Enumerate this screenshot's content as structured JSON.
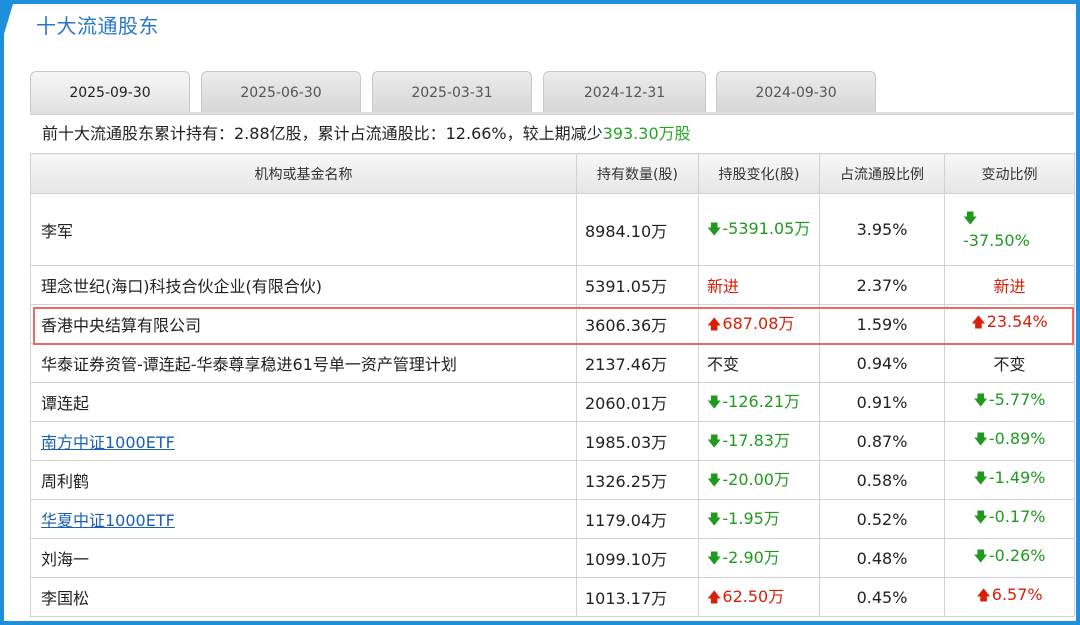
{
  "section": {
    "title": "十大流通股东"
  },
  "tabs": [
    {
      "label": "2025-09-30",
      "active": true
    },
    {
      "label": "2025-06-30",
      "active": false
    },
    {
      "label": "2025-03-31",
      "active": false
    },
    {
      "label": "2024-12-31",
      "active": false
    },
    {
      "label": "2024-09-30",
      "active": false
    }
  ],
  "summary": {
    "prefix": "前十大流通股东累计持有：2.88亿股，累计占流通股比：12.66%，较上期减少",
    "change": "393.30万股"
  },
  "table": {
    "headers": [
      "机构或基金名称",
      "持有数量(股)",
      "持股变化(股)",
      "占流通股比例",
      "变动比例"
    ],
    "rows": [
      {
        "name": "李军",
        "shares": "8984.10万",
        "change": "-5391.05万",
        "pct": "3.95%",
        "change_ratio": "-37.50%"
      },
      {
        "name": "理念世纪(海口)科技合伙企业(有限合伙)",
        "shares": "5391.05万",
        "change": "新进",
        "pct": "2.37%",
        "change_ratio": "新进"
      },
      {
        "name": "香港中央结算有限公司",
        "shares": "3606.36万",
        "change": "687.08万",
        "pct": "1.59%",
        "change_ratio": "23.54%"
      },
      {
        "name": "华泰证券资管-谭连起-华泰尊享稳进61号单一资产管理计划",
        "shares": "2137.46万",
        "change": "不变",
        "pct": "0.94%",
        "change_ratio": "不变"
      },
      {
        "name": "谭连起",
        "shares": "2060.01万",
        "change": "-126.21万",
        "pct": "0.91%",
        "change_ratio": "-5.77%"
      },
      {
        "name": "南方中证1000ETF",
        "shares": "1985.03万",
        "change": "-17.83万",
        "pct": "0.87%",
        "change_ratio": "-0.89%"
      },
      {
        "name": "周利鹤",
        "shares": "1326.25万",
        "change": "-20.00万",
        "pct": "0.58%",
        "change_ratio": "-1.49%"
      },
      {
        "name": "华夏中证1000ETF",
        "shares": "1179.04万",
        "change": "-1.95万",
        "pct": "0.52%",
        "change_ratio": "-0.17%"
      },
      {
        "name": "刘海一",
        "shares": "1099.10万",
        "change": "-2.90万",
        "pct": "0.48%",
        "change_ratio": "-0.26%"
      },
      {
        "name": "李国松",
        "shares": "1013.17万",
        "change": "62.50万",
        "pct": "0.45%",
        "change_ratio": "6.57%"
      }
    ]
  },
  "colors": {
    "accent": "#1e8fdc",
    "up": "#d81e06",
    "down": "#1f9a1f",
    "summary_change": "#27a227",
    "highlight": "#e96a6a",
    "link": "#1a5fb4"
  },
  "icons": {
    "up": "arrow-up-icon",
    "down": "arrow-down-icon"
  }
}
